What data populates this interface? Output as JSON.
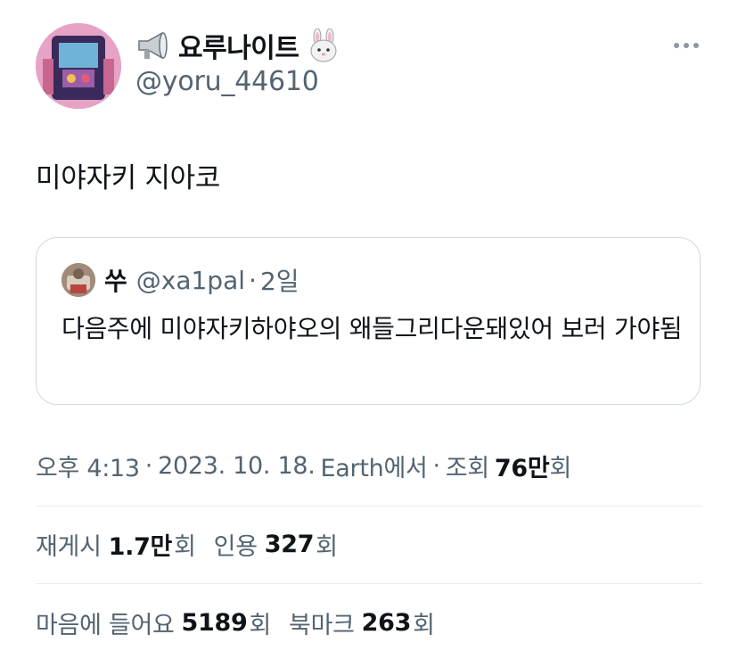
{
  "author": {
    "display_name": "요루나이트",
    "handle": "@yoru_44610"
  },
  "tweet": {
    "text": "미야자키 지아코"
  },
  "quote": {
    "name": "쑤",
    "handle": "@xa1pal",
    "separator": "·",
    "age": "2일",
    "text": "다음주에  미야자키하야오의  왜들그리다운돼있어  보러 가야됨"
  },
  "meta": {
    "time": "오후 4:13",
    "sep1": "·",
    "date": "2023. 10. 18.",
    "source": "Earth에서",
    "sep2": "·",
    "views_label": "조회",
    "views_value": "76만",
    "views_suffix": "회"
  },
  "stats": {
    "retweets_label": "재게시",
    "retweets_value": "1.7만",
    "retweets_suffix": "회",
    "quotes_label": "인용",
    "quotes_value": "327",
    "quotes_suffix": "회",
    "likes_label": "마음에 들어요",
    "likes_value": "5189",
    "likes_suffix": "회",
    "bookmarks_label": "북마크",
    "bookmarks_value": "263",
    "bookmarks_suffix": "회"
  },
  "icons": {
    "more": "more-icon",
    "megaphone": "megaphone-icon",
    "rabbit": "rabbit-icon"
  },
  "colors": {
    "text": "#0f1419",
    "secondary": "#536471",
    "border": "#cfd9de"
  }
}
